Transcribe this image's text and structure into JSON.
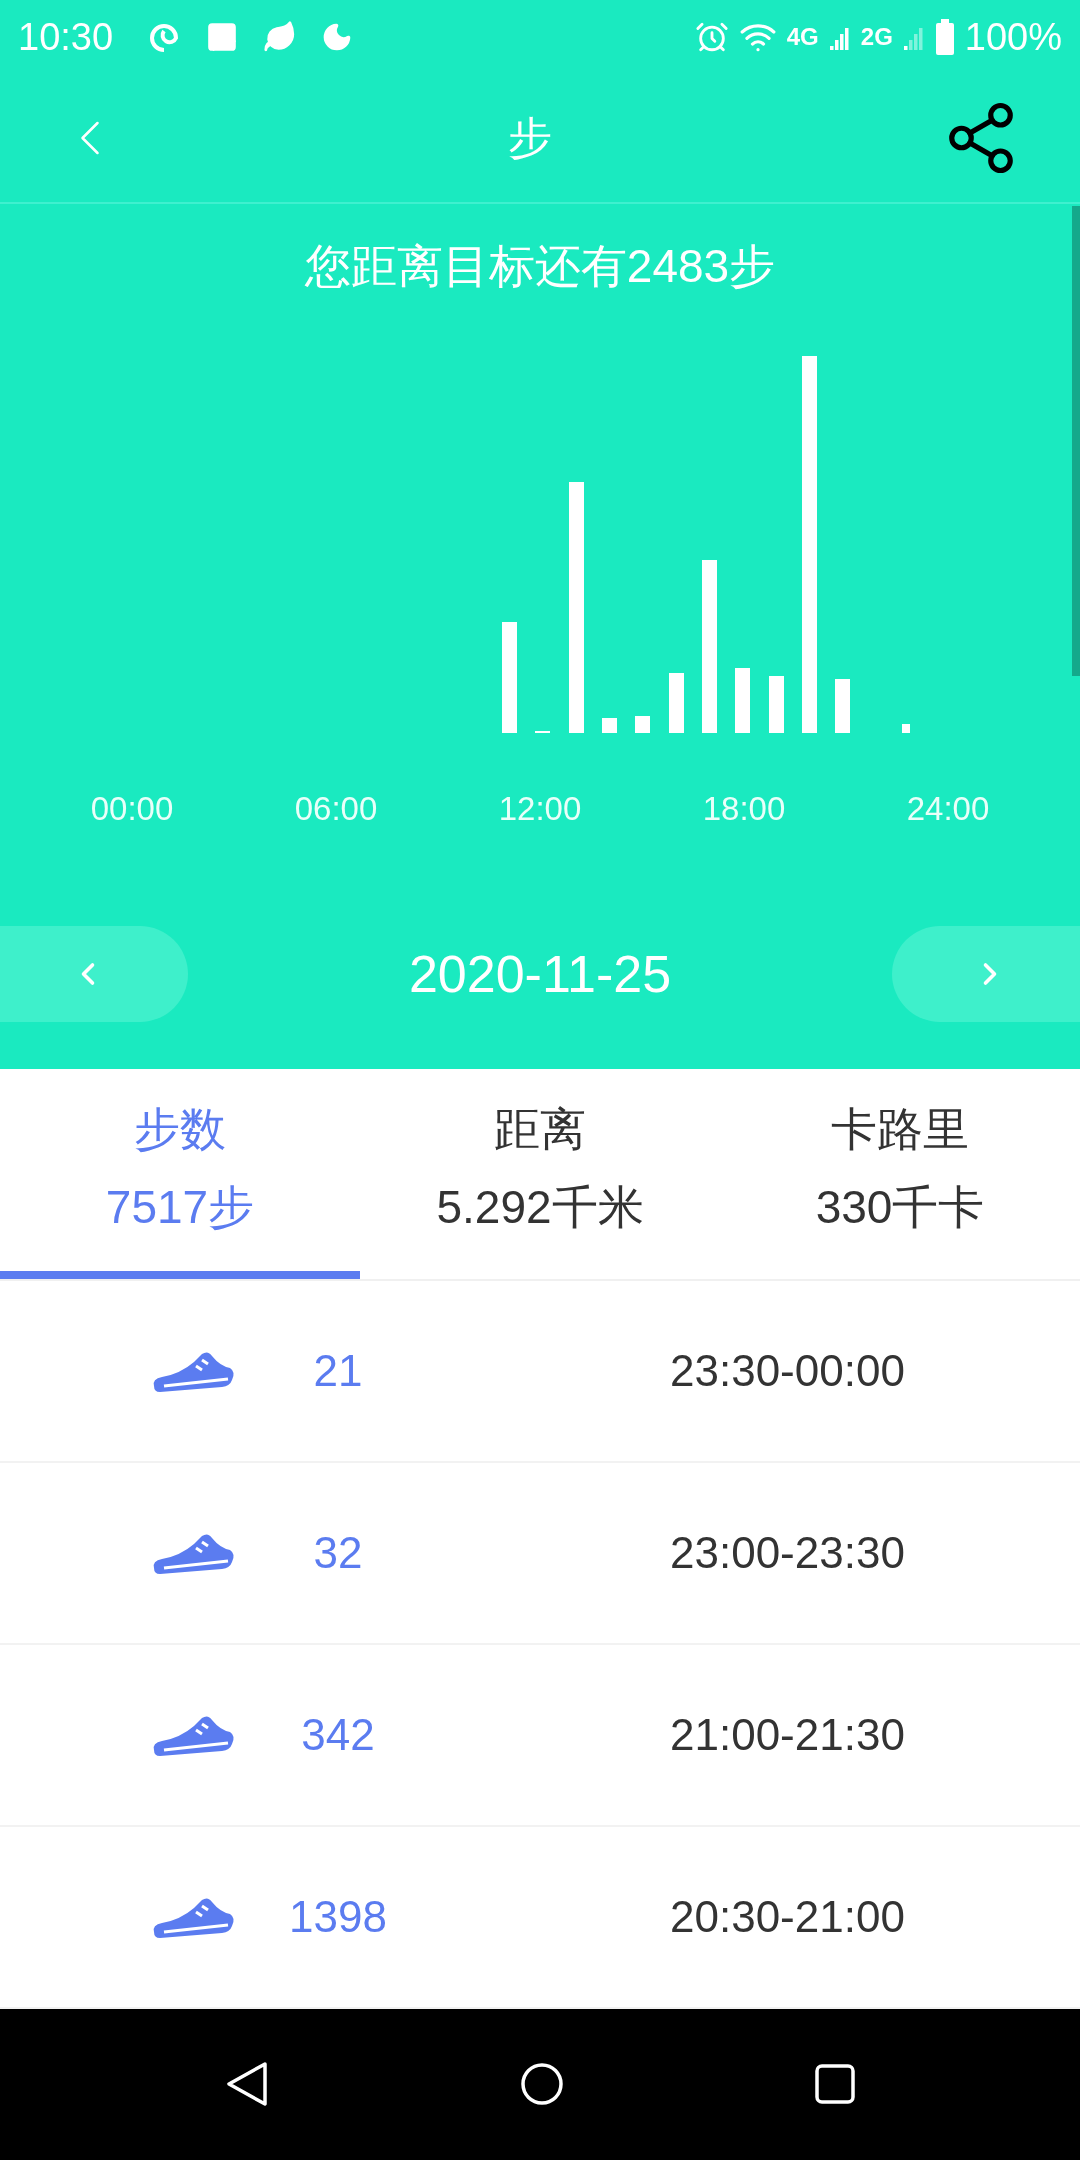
{
  "status_bar": {
    "time": "10:30",
    "network_labels": [
      "4G",
      "2G"
    ],
    "battery": "100%"
  },
  "header": {
    "title": "步"
  },
  "goal_text": "您距离目标还有2483步",
  "chart_time_labels": [
    "00:00",
    "06:00",
    "12:00",
    "18:00",
    "24:00"
  ],
  "date": "2020-11-25",
  "tabs": [
    {
      "label": "步数",
      "value": "7517步",
      "selected": true
    },
    {
      "label": "距离",
      "value": "5.292千米",
      "selected": false
    },
    {
      "label": "卡路里",
      "value": "330千卡",
      "selected": false
    }
  ],
  "records": [
    {
      "steps": "21",
      "time_range": "23:30-00:00"
    },
    {
      "steps": "32",
      "time_range": "23:00-23:30"
    },
    {
      "steps": "342",
      "time_range": "21:00-21:30"
    },
    {
      "steps": "1398",
      "time_range": "20:30-21:00"
    }
  ]
}
